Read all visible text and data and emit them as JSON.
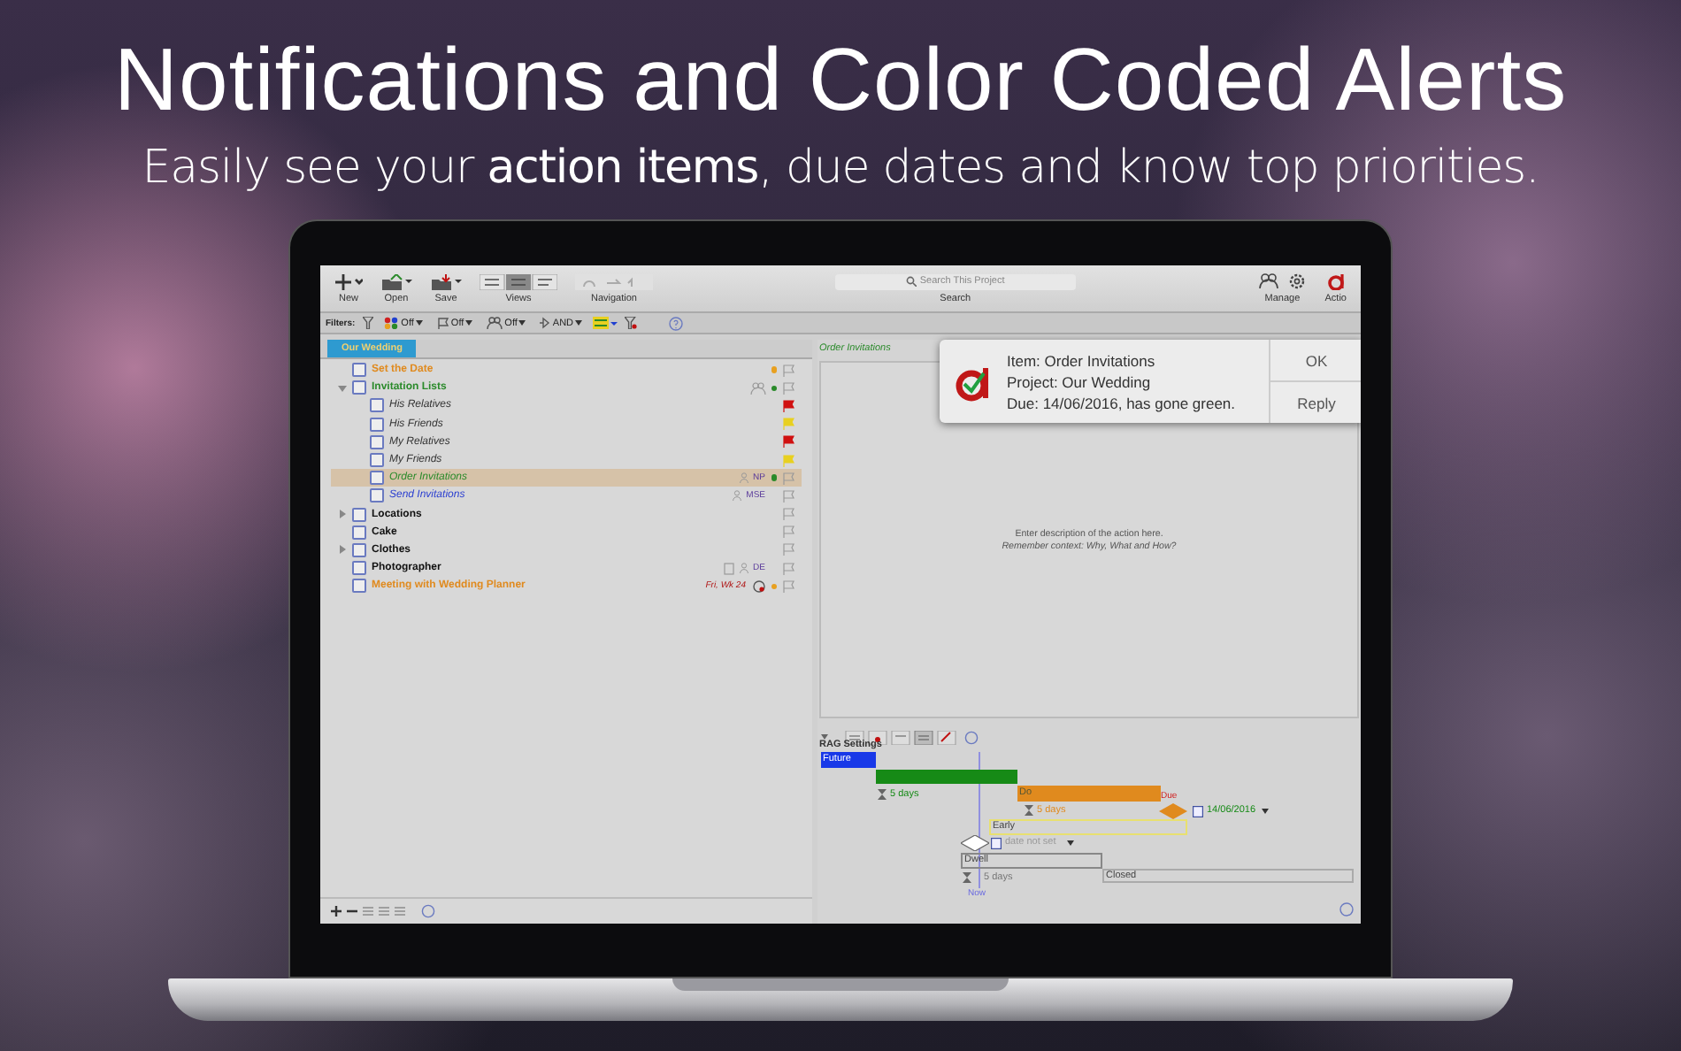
{
  "headline": "Notifications and Color Coded Alerts",
  "subheadline": "Easily see your **action items**, due dates and know top priorities.",
  "toolbar": {
    "tools": [
      {
        "label": "New",
        "kind": "new"
      },
      {
        "label": "Open",
        "kind": "open"
      },
      {
        "label": "Save",
        "kind": "save"
      },
      {
        "label": "Views",
        "kind": "views"
      },
      {
        "label": "Navigation",
        "kind": "nav"
      }
    ],
    "search": {
      "placeholder": "Search This Project",
      "label": "Search"
    },
    "right_tools": [
      {
        "label": "Manage",
        "kind": "manage"
      },
      {
        "label": "Actio",
        "kind": "logo"
      }
    ]
  },
  "filters": {
    "label": "Filters:",
    "values": [
      "Off",
      "Off",
      "Off",
      "AND"
    ]
  },
  "project_tab": "Our Wedding",
  "tasks": [
    {
      "title": "Set the Date",
      "color": "#e08a1e",
      "checked": false,
      "selected": false,
      "dot": {
        "color": "#e8a020"
      }
    },
    {
      "title": "Invitation Lists",
      "color": "#2a8a2a",
      "checked": false,
      "selected": false,
      "expanded": true,
      "dot": {
        "color": "#2a8a2a"
      },
      "children": [
        {
          "title": "His Relatives",
          "color": "#333333",
          "checked": false,
          "selected": false,
          "flag": {
            "color": "#d01010"
          }
        },
        {
          "title": "His Friends",
          "color": "#333333",
          "checked": false,
          "selected": false,
          "flag": {
            "color": "#e8d020"
          }
        },
        {
          "title": "My Relatives",
          "color": "#333333",
          "checked": false,
          "selected": false,
          "flag": {
            "color": "#d01010"
          }
        },
        {
          "title": "My Friends",
          "color": "#333333",
          "checked": false,
          "selected": false,
          "flag": {
            "color": "#e8d020"
          }
        },
        {
          "title": "Order Invitations",
          "color": "#2a8a2a",
          "checked": false,
          "selected": true,
          "assignee": "NP",
          "dot": {
            "color": "#2a8a2a"
          }
        },
        {
          "title": "Send Invitations",
          "color": "#2b3fd0",
          "checked": false,
          "selected": false,
          "assignee": "MSE"
        }
      ]
    },
    {
      "title": "Locations",
      "color": "#111111",
      "checked": false,
      "selected": false,
      "expanded": false
    },
    {
      "title": "Cake",
      "color": "#111111",
      "checked": false,
      "selected": false
    },
    {
      "title": "Clothes",
      "color": "#111111",
      "checked": false,
      "selected": false,
      "expanded": false
    },
    {
      "title": "Photographer",
      "color": "#111111",
      "checked": false,
      "selected": false,
      "assignee": "DE"
    },
    {
      "title": "Meeting with Wedding Planner",
      "color": "#e08a1e",
      "checked": false,
      "selected": false,
      "date": "Fri, Wk 24",
      "dot": {
        "color": "#e8a020"
      }
    }
  ],
  "detail": {
    "title": "Order Invitations",
    "placeholder": "Enter description of the action here.",
    "hint": "Remember context: Why, What and How?"
  },
  "notification": {
    "item": "Item: Order Invitations",
    "project": "Project: Our Wedding",
    "due": "Due: 14/06/2016, has gone green.",
    "buttons": [
      "OK",
      "Reply"
    ]
  },
  "rag": {
    "title": "RAG Settings",
    "future": "Future",
    "do": "Do",
    "due": "Due",
    "early": "Early",
    "dwell": "Dwell",
    "closed": "Closed",
    "durations": [
      "5 days",
      "5 days",
      "5 days"
    ],
    "due_date": "14/06/2016",
    "start_date": "date not set",
    "now": "Now"
  }
}
